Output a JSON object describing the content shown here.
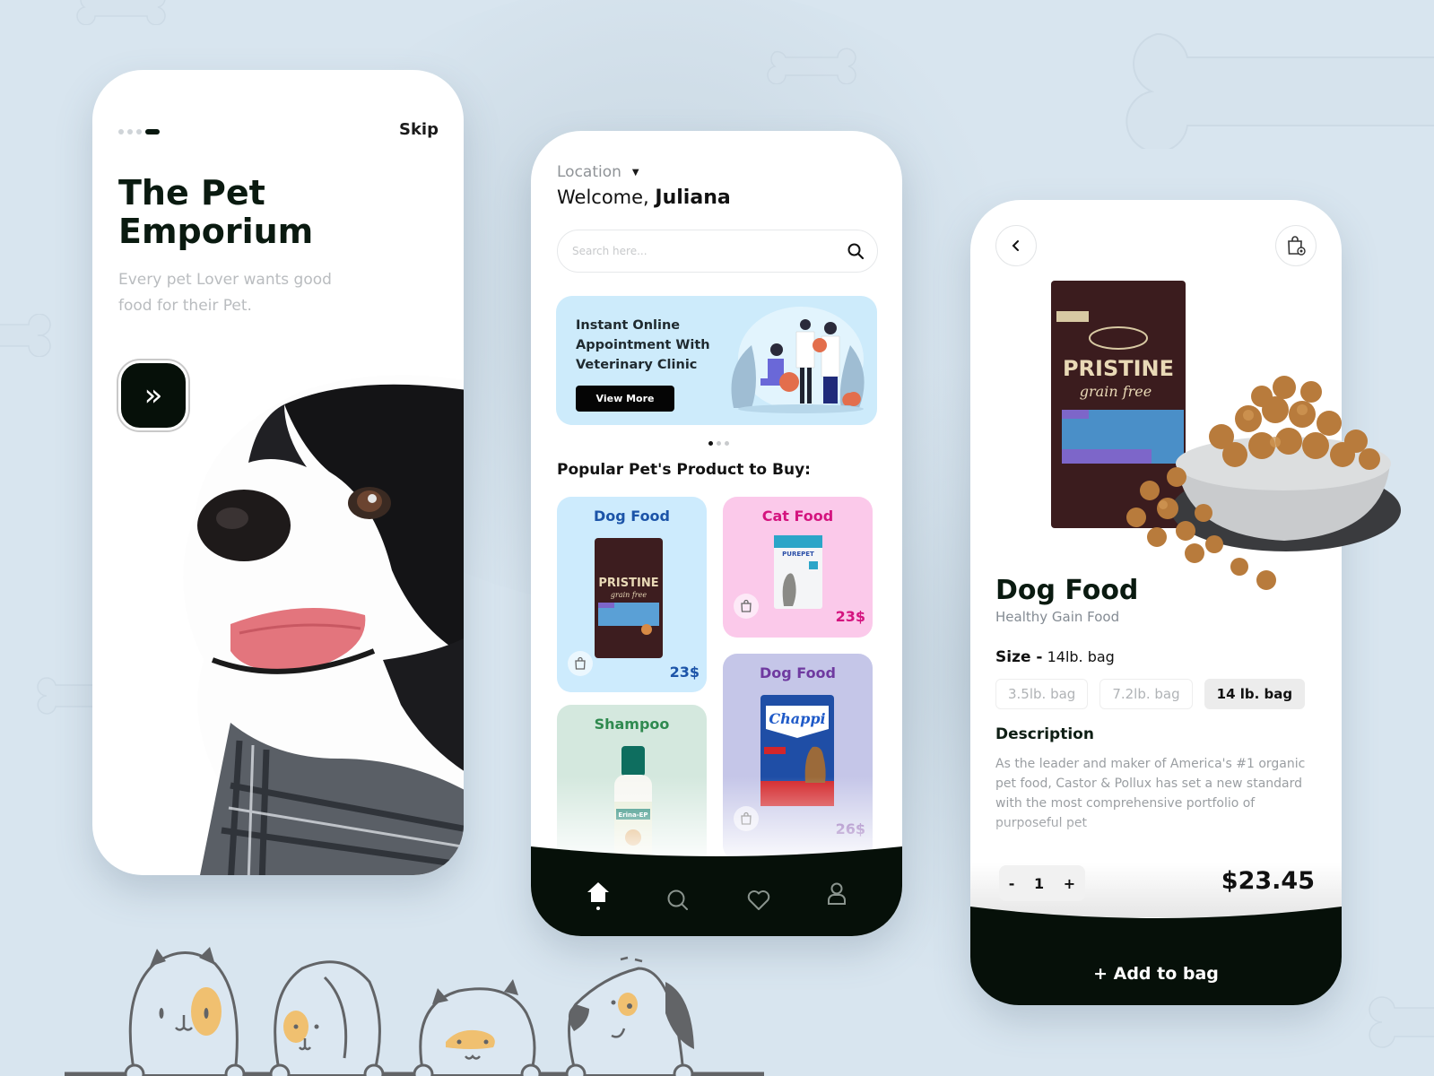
{
  "colors": {
    "background": "#d8e5ef",
    "dark": "#061009",
    "dog_food_blue": "#1c54a8",
    "cat_food_pink": "#d4147f",
    "shampoo_green": "#2f8a4f",
    "dog_food_purple": "#6f3aa0"
  },
  "onboarding": {
    "skip_label": "Skip",
    "pager_total": 4,
    "pager_active": 4,
    "title": "The Pet Emporium",
    "subtitle": "Every pet Lover wants good food for their Pet.",
    "next_icon": "double-chevron-right-icon"
  },
  "home": {
    "location_label": "Location",
    "welcome_prefix": "Welcome,",
    "user_name": "Juliana",
    "search_placeholder": "Search here...",
    "banner": {
      "title": "Instant Online Appointment With Veterinary Clinic",
      "button_label": "View More",
      "pager_total": 3,
      "pager_active": 1
    },
    "section_title": "Popular Pet's Product to Buy:",
    "products": [
      {
        "category": "Dog Food",
        "brand": "PRISTINE",
        "price": "23$"
      },
      {
        "category": "Cat Food",
        "brand": "PUREPET",
        "price": "23$"
      },
      {
        "category": "Shampoo",
        "brand": "Erina-EP",
        "price": ""
      },
      {
        "category": "Dog Food",
        "brand": "Chappi",
        "price": "26$"
      }
    ],
    "nav": [
      {
        "name": "home",
        "icon": "home-icon",
        "active": true
      },
      {
        "name": "search",
        "icon": "search-icon",
        "active": false
      },
      {
        "name": "favorites",
        "icon": "heart-icon",
        "active": false
      },
      {
        "name": "profile",
        "icon": "user-icon",
        "active": false
      }
    ]
  },
  "detail": {
    "product_brand": "PRISTINE",
    "product_subbrand": "grain free",
    "product_name": "Dog Food",
    "product_subtitle": "Healthy Gain Food",
    "size_label": "Size -",
    "size_value": "14lb. bag",
    "sizes": [
      "3.5lb. bag",
      "7.2lb. bag",
      "14 lb. bag"
    ],
    "selected_size": "14 lb. bag",
    "description_heading": "Description",
    "description": "As the leader and maker of America's #1 organic pet food, Castor & Pollux has set a new standard with the most comprehensive portfolio of purposeful pet",
    "qty_minus": "-",
    "qty_value": "1",
    "qty_plus": "+",
    "price": "$23.45",
    "add_button_label": "+ Add to bag"
  }
}
